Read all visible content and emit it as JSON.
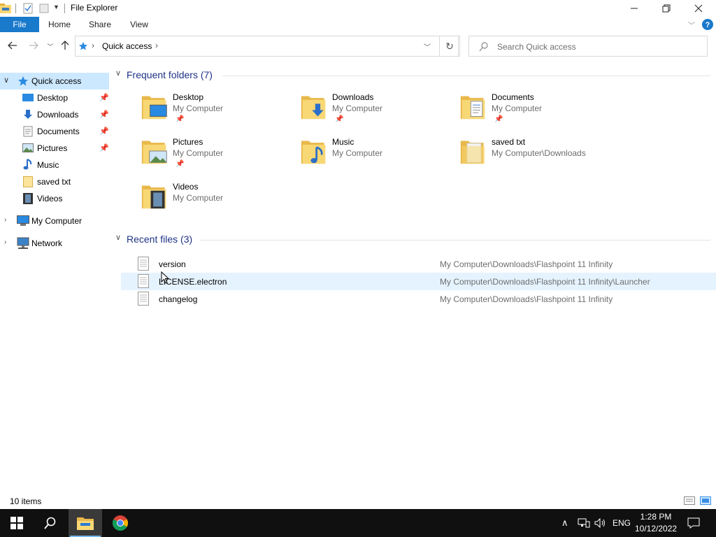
{
  "window": {
    "title": "File Explorer"
  },
  "ribbon": {
    "tabs": [
      "File",
      "Home",
      "Share",
      "View"
    ]
  },
  "address": {
    "root": "Quick access"
  },
  "search": {
    "placeholder": "Search Quick access"
  },
  "nav": {
    "quick_access": "Quick access",
    "items": [
      {
        "label": "Desktop",
        "icon": "desktop-icon",
        "pinned": true
      },
      {
        "label": "Downloads",
        "icon": "downloads-icon",
        "pinned": true
      },
      {
        "label": "Documents",
        "icon": "documents-icon",
        "pinned": true
      },
      {
        "label": "Pictures",
        "icon": "pictures-icon",
        "pinned": true
      },
      {
        "label": "Music",
        "icon": "music-icon",
        "pinned": false
      },
      {
        "label": "saved txt",
        "icon": "folder-icon",
        "pinned": false
      },
      {
        "label": "Videos",
        "icon": "videos-icon",
        "pinned": false
      }
    ],
    "my_computer": "My Computer",
    "network": "Network"
  },
  "frequent": {
    "header": "Frequent folders (7)",
    "folders": [
      {
        "name": "Desktop",
        "location": "My Computer",
        "pinned": true
      },
      {
        "name": "Downloads",
        "location": "My Computer",
        "pinned": true
      },
      {
        "name": "Documents",
        "location": "My Computer",
        "pinned": true
      },
      {
        "name": "Pictures",
        "location": "My Computer",
        "pinned": true
      },
      {
        "name": "Music",
        "location": "My Computer",
        "pinned": false
      },
      {
        "name": "saved txt",
        "location": "My Computer\\Downloads",
        "pinned": false
      },
      {
        "name": "Videos",
        "location": "My Computer",
        "pinned": false
      }
    ]
  },
  "recent": {
    "header": "Recent files (3)",
    "files": [
      {
        "name": "version",
        "path": "My Computer\\Downloads\\Flashpoint 11 Infinity"
      },
      {
        "name": "LICENSE.electron",
        "path": "My Computer\\Downloads\\Flashpoint 11 Infinity\\Launcher"
      },
      {
        "name": "changelog",
        "path": "My Computer\\Downloads\\Flashpoint 11 Infinity"
      }
    ]
  },
  "status": {
    "items": "10 items"
  },
  "taskbar": {
    "language": "ENG",
    "time": "1:28 PM",
    "date": "10/12/2022"
  },
  "colors": {
    "accent": "#1979ca",
    "selection": "#cce8ff",
    "hover": "#e5f3ff",
    "group_header": "#1e3287",
    "folder": "#f8d775"
  }
}
